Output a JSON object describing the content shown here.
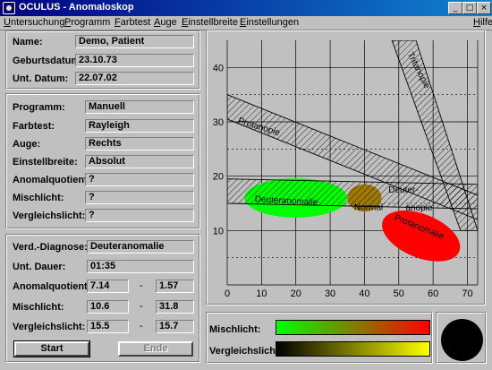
{
  "window": {
    "title": "OCULUS - Anomaloskop"
  },
  "menu": [
    "Untersuchung",
    "Programm",
    "Farbtest",
    "Auge",
    "Einstellbreite",
    "Einstellungen",
    "Hilfe"
  ],
  "patient": {
    "name_label": "Name:",
    "name": "Demo, Patient",
    "dob_label": "Geburtsdatum:",
    "dob": "23.10.73",
    "exam_date_label": "Unt. Datum:",
    "exam_date": "22.07.02"
  },
  "settings": {
    "program_label": "Programm:",
    "program": "Manuell",
    "colortest_label": "Farbtest:",
    "colortest": "Rayleigh",
    "eye_label": "Auge:",
    "eye": "Rechts",
    "width_label": "Einstellbreite:",
    "width": "Absolut",
    "aq_label": "Anomalquotient:",
    "aq": "?",
    "mix_label": "Mischlicht:",
    "mix": "?",
    "comp_label": "Vergleichslicht:",
    "comp": "?"
  },
  "results": {
    "diag_label": "Verd.-Diagnose:",
    "diag": "Deuteranomalie",
    "duration_label": "Unt. Dauer:",
    "duration": "01:35",
    "aq_label": "Anomalquotient:",
    "aq_min": "7.14",
    "aq_max": "1.57",
    "mix_label": "Mischlicht:",
    "mix_min": "10.6",
    "mix_max": "31.8",
    "comp_label": "Vergleichslicht:",
    "comp_min": "15.5",
    "comp_max": "15.7",
    "dash": "-"
  },
  "buttons": {
    "start": "Start",
    "end": "Ende"
  },
  "chart_data": {
    "type": "scatter",
    "xlim": [
      0,
      73
    ],
    "ylim": [
      0,
      45
    ],
    "xticks": [
      0,
      10,
      20,
      30,
      40,
      50,
      60,
      70
    ],
    "yticks": [
      10,
      20,
      30,
      40
    ],
    "bands": [
      {
        "label": "Protanopie",
        "polygon": [
          [
            0,
            35
          ],
          [
            0,
            30.5
          ],
          [
            73,
            12
          ],
          [
            73,
            16.5
          ]
        ]
      },
      {
        "label": "Deuteranopie",
        "polygon": [
          [
            0,
            19.5
          ],
          [
            0,
            15
          ],
          [
            73,
            14
          ],
          [
            73,
            18.5
          ]
        ]
      },
      {
        "label": "Tritanopie",
        "polygon": [
          [
            48,
            45
          ],
          [
            55,
            45
          ],
          [
            73,
            10
          ],
          [
            68,
            10
          ]
        ]
      }
    ],
    "regions": [
      {
        "label": "Deuteranomalie",
        "cx": 20,
        "cy": 16,
        "rx": 15,
        "ry": 3.6,
        "color": "#00ff00"
      },
      {
        "label": "Normal",
        "cx": 40,
        "cy": 16,
        "rx": 5,
        "ry": 2.5,
        "color": "#a07a00"
      },
      {
        "label": "Protanomalie",
        "cx": 56.5,
        "cy": 9,
        "rx": 12,
        "ry": 4,
        "color": "#ff0000"
      }
    ]
  },
  "gauges": {
    "mix_label": "Mischlicht:",
    "comp_label": "Vergleichslicht:",
    "mix_colors": [
      "#00ff00",
      "#ff0000"
    ],
    "comp_colors": [
      "#000000",
      "#ffff00"
    ]
  }
}
